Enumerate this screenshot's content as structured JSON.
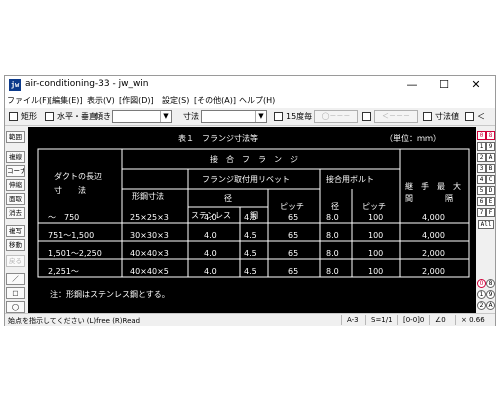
{
  "window": {
    "title": "air-conditioning-33 - jw_win",
    "icon_label": "jw",
    "controls": [
      "—",
      "☐",
      "✕"
    ]
  },
  "menu": [
    "ファイル(F)",
    "[編集(E)]",
    "表示(V)",
    "[作図(D)]",
    "設定(S)",
    "[その他(A)]",
    "ヘルプ(H)"
  ],
  "toolbar": {
    "rect_label": "矩形",
    "hv_label": "水平・垂直",
    "tilt_label": "傾き",
    "dim_label": "寸法",
    "fifteen_label": "15度毎",
    "disabled_a": "◯－－－",
    "disabled_b": "＜－－－",
    "dimval_label": "寸法値",
    "last_label": "＜"
  },
  "left_tools": [
    "範囲",
    "複線",
    "コーナー",
    "伸縮",
    "面取",
    "消去",
    "複写",
    "移動",
    "戻る",
    "／",
    "□",
    "◯"
  ],
  "right_tools": {
    "layers_a": [
      "0",
      "1",
      "2",
      "3",
      "4",
      "5",
      "6",
      "7"
    ],
    "layers_b": [
      "8",
      "9",
      "A",
      "B",
      "C",
      "D",
      "E",
      "F"
    ],
    "all_label": "All",
    "bottom_round_a": [
      "0",
      "1",
      "2"
    ],
    "bottom_round_b": [
      "8",
      "9",
      "A"
    ]
  },
  "drawing": {
    "caption": "表１　フランジ寸法等",
    "unit": "（単位：ｍｍ）",
    "header": {
      "duct_length": "ダクトの長辺",
      "duct_dim": "寸　　法",
      "joint_flange": "接　合　フ　ラ　ン　ジ",
      "flange_rivet": "フランジ取付用リベット",
      "shape_steel": "形鋼寸法",
      "diameter": "径",
      "stainless": "ステンレス",
      "steel": "鋼",
      "pitch": "ピッチ",
      "joint_bolt": "接合用ボルト",
      "bolt_dia": "径",
      "bolt_pitch": "ピッチ",
      "fitting_max": "継　手　最　大",
      "interval": "間　　　　隔"
    },
    "rows": [
      {
        "range": "～　750",
        "shape": "25×25×3",
        "d_sus": "4.0",
        "d_steel": "4.5",
        "pitch": "65",
        "bolt_d": "8.0",
        "bolt_p": "100",
        "max": "4,000"
      },
      {
        "range": "751～1,500",
        "shape": "30×30×3",
        "d_sus": "4.0",
        "d_steel": "4.5",
        "pitch": "65",
        "bolt_d": "8.0",
        "bolt_p": "100",
        "max": "4,000"
      },
      {
        "range": "1,501～2,250",
        "shape": "40×40×3",
        "d_sus": "4.0",
        "d_steel": "4.5",
        "pitch": "65",
        "bolt_d": "8.0",
        "bolt_p": "100",
        "max": "2,000"
      },
      {
        "range": "2,251～",
        "shape": "40×40×5",
        "d_sus": "4.0",
        "d_steel": "4.5",
        "pitch": "65",
        "bolt_d": "8.0",
        "bolt_p": "100",
        "max": "2,000"
      }
    ],
    "note": "注：形鋼はステンレス鋼とする。"
  },
  "status": {
    "hint": "始点を指示してください (L)free (R)Read",
    "paper": "A-3",
    "scale": "S=1/1",
    "layer": "[0-0]0",
    "angle": "∠0",
    "zoom": "× 0.66"
  },
  "colors": {
    "canvas_bg": "#000000",
    "drawing_line": "#ffffff",
    "active_accent": "#d0003a"
  }
}
